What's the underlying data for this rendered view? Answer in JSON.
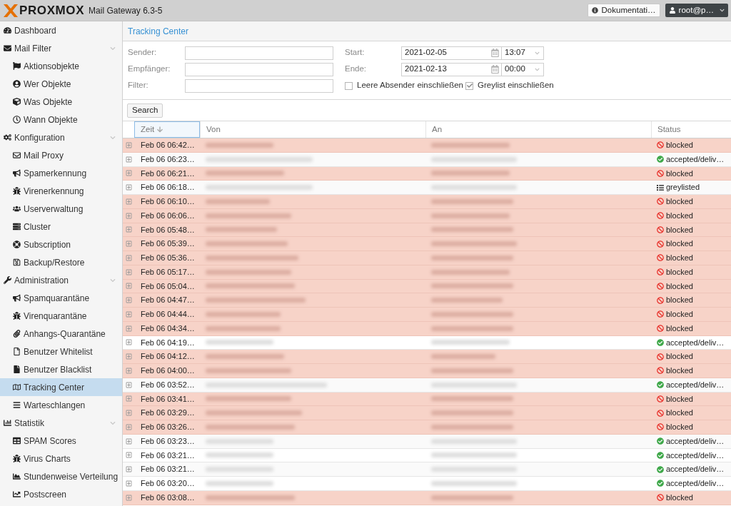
{
  "header": {
    "logo": "PROXMOX",
    "product": "Mail Gateway 6.3-5",
    "docs_button": "Dokumentati…",
    "user_button": "root@p…"
  },
  "sidebar": {
    "items": [
      {
        "label": "Dashboard",
        "selected": false
      },
      {
        "label": "Mail Filter",
        "selected": false,
        "expanded": true,
        "children": [
          {
            "label": "Aktionsobjekte",
            "selected": false
          },
          {
            "label": "Wer Objekte",
            "selected": false
          },
          {
            "label": "Was Objekte",
            "selected": false
          },
          {
            "label": "Wann Objekte",
            "selected": false
          }
        ]
      },
      {
        "label": "Konfiguration",
        "selected": false,
        "expanded": true,
        "children": [
          {
            "label": "Mail Proxy",
            "selected": false
          },
          {
            "label": "Spamerkennung",
            "selected": false
          },
          {
            "label": "Virenerkennung",
            "selected": false
          },
          {
            "label": "Userverwaltung",
            "selected": false
          },
          {
            "label": "Cluster",
            "selected": false
          },
          {
            "label": "Subscription",
            "selected": false
          },
          {
            "label": "Backup/Restore",
            "selected": false
          }
        ]
      },
      {
        "label": "Administration",
        "selected": false,
        "expanded": true,
        "children": [
          {
            "label": "Spamquarantäne",
            "selected": false
          },
          {
            "label": "Virenquarantäne",
            "selected": false
          },
          {
            "label": "Anhangs-Quarantäne",
            "selected": false
          },
          {
            "label": "Benutzer Whitelist",
            "selected": false
          },
          {
            "label": "Benutzer Blacklist",
            "selected": false
          },
          {
            "label": "Tracking Center",
            "selected": true
          },
          {
            "label": "Warteschlangen",
            "selected": false
          }
        ]
      },
      {
        "label": "Statistik",
        "selected": false,
        "expanded": true,
        "children": [
          {
            "label": "SPAM Scores",
            "selected": false
          },
          {
            "label": "Virus Charts",
            "selected": false
          },
          {
            "label": "Stundenweise Verteilung",
            "selected": false
          },
          {
            "label": "Postscreen",
            "selected": false
          }
        ]
      }
    ]
  },
  "panel": {
    "title": "Tracking Center"
  },
  "form": {
    "fields": [
      {
        "label": "Sender:"
      },
      {
        "label": "Empfänger:"
      },
      {
        "label": "Filter:"
      }
    ],
    "start": {
      "label": "Start:",
      "date": "2021-02-05",
      "time": "13:07"
    },
    "end": {
      "label": "Ende:",
      "date": "2021-02-13",
      "time": "00:00"
    },
    "checkboxes": [
      {
        "label": "Leere Absender einschließen",
        "checked": false
      },
      {
        "label": "Greylist einschließen",
        "checked": true
      }
    ]
  },
  "toolbar": {
    "search_button": "Search"
  },
  "table": {
    "columns": [
      {
        "label": "Zeit",
        "focused": true,
        "sort_descending": true
      },
      {
        "label": "Von",
        "focused": false,
        "sort_descending": false
      },
      {
        "label": "An",
        "focused": false,
        "sort_descending": false
      },
      {
        "label": "Status",
        "focused": false,
        "sort_descending": false
      }
    ],
    "rows": [
      {
        "time": "Feb 06 06:42…",
        "status": "blocked",
        "kind": "blocked",
        "expanded": false
      },
      {
        "time": "Feb 06 06:23…",
        "status": "accepted/deliv…",
        "kind": "accepted",
        "expanded": false
      },
      {
        "time": "Feb 06 06:21…",
        "status": "blocked",
        "kind": "blocked",
        "expanded": false
      },
      {
        "time": "Feb 06 06:18…",
        "status": "greylisted",
        "kind": "greylisted",
        "expanded": false
      },
      {
        "time": "Feb 06 06:10…",
        "status": "blocked",
        "kind": "blocked",
        "expanded": false
      },
      {
        "time": "Feb 06 06:06…",
        "status": "blocked",
        "kind": "blocked",
        "expanded": false
      },
      {
        "time": "Feb 06 05:48…",
        "status": "blocked",
        "kind": "blocked",
        "expanded": false
      },
      {
        "time": "Feb 06 05:39…",
        "status": "blocked",
        "kind": "blocked",
        "expanded": false
      },
      {
        "time": "Feb 06 05:36…",
        "status": "blocked",
        "kind": "blocked",
        "expanded": false
      },
      {
        "time": "Feb 06 05:17…",
        "status": "blocked",
        "kind": "blocked",
        "expanded": false
      },
      {
        "time": "Feb 06 05:04…",
        "status": "blocked",
        "kind": "blocked",
        "expanded": false
      },
      {
        "time": "Feb 06 04:47…",
        "status": "blocked",
        "kind": "blocked",
        "expanded": false
      },
      {
        "time": "Feb 06 04:44…",
        "status": "blocked",
        "kind": "blocked",
        "expanded": false
      },
      {
        "time": "Feb 06 04:34…",
        "status": "blocked",
        "kind": "blocked",
        "expanded": false
      },
      {
        "time": "Feb 06 04:19…",
        "status": "accepted/deliv…",
        "kind": "accepted",
        "expanded": false
      },
      {
        "time": "Feb 06 04:12…",
        "status": "blocked",
        "kind": "blocked",
        "expanded": false
      },
      {
        "time": "Feb 06 04:00…",
        "status": "blocked",
        "kind": "blocked",
        "expanded": false
      },
      {
        "time": "Feb 06 03:52…",
        "status": "accepted/deliv…",
        "kind": "accepted",
        "expanded": false
      },
      {
        "time": "Feb 06 03:41…",
        "status": "blocked",
        "kind": "blocked",
        "expanded": false
      },
      {
        "time": "Feb 06 03:29…",
        "status": "blocked",
        "kind": "blocked",
        "expanded": false
      },
      {
        "time": "Feb 06 03:26…",
        "status": "blocked",
        "kind": "blocked",
        "expanded": false
      },
      {
        "time": "Feb 06 03:23…",
        "status": "accepted/deliv…",
        "kind": "accepted",
        "expanded": false
      },
      {
        "time": "Feb 06 03:21…",
        "status": "accepted/deliv…",
        "kind": "accepted",
        "expanded": false
      },
      {
        "time": "Feb 06 03:21…",
        "status": "accepted/deliv…",
        "kind": "accepted",
        "expanded": false
      },
      {
        "time": "Feb 06 03:20…",
        "status": "accepted/deliv…",
        "kind": "accepted",
        "expanded": false
      },
      {
        "time": "Feb 06 03:08…",
        "status": "blocked",
        "kind": "blocked",
        "expanded": false
      }
    ]
  }
}
